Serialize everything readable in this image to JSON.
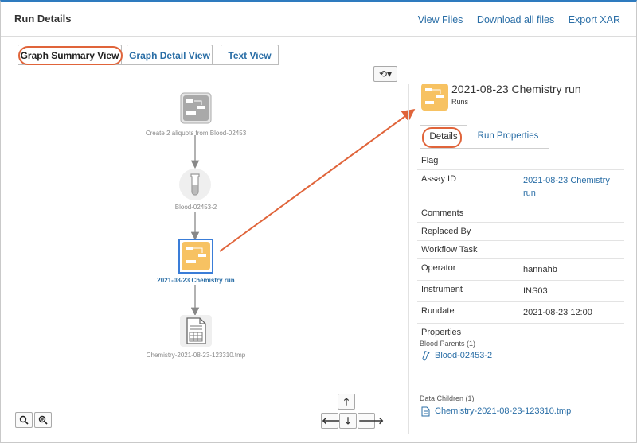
{
  "header": {
    "title": "Run Details",
    "links": [
      "View Files",
      "Download all files",
      "Export XAR"
    ]
  },
  "tabs": [
    "Graph Summary View",
    "Graph Detail View",
    "Text View"
  ],
  "reset_icon": "refresh-dropdown-icon",
  "graph": {
    "nodes": [
      {
        "label": "Create 2 aliquots from Blood-02453",
        "icon": "protocol-icon"
      },
      {
        "label": "Blood-02453-2",
        "icon": "test-tube-icon"
      },
      {
        "label": "2021-08-23 Chemistry run",
        "icon": "assay-run-icon"
      },
      {
        "label": "Chemistry-2021-08-23-123310.tmp",
        "icon": "data-file-icon"
      }
    ]
  },
  "zoom": {
    "zoom_out": "zoom-out-icon",
    "zoom_in": "zoom-in-icon"
  },
  "nav_glyphs": {
    "up": "🡑",
    "left": "🡐",
    "down": "🡓",
    "right": "🡒"
  },
  "detail": {
    "title": "2021-08-23 Chemistry run",
    "subtitle": "Runs",
    "tabs": [
      "Details",
      "Run Properties"
    ],
    "properties": [
      {
        "key": "Flag",
        "value": ""
      },
      {
        "key": "Assay ID",
        "value": "2021-08-23 Chemistry run"
      },
      {
        "key": "Comments",
        "value": ""
      },
      {
        "key": "Replaced By",
        "value": ""
      },
      {
        "key": "Workflow Task",
        "value": ""
      },
      {
        "key": "Operator",
        "value": "hannahb"
      },
      {
        "key": "Instrument",
        "value": "INS03"
      },
      {
        "key": "Rundate",
        "value": "2021-08-23 12:00"
      },
      {
        "key": "Properties",
        "value": ""
      }
    ],
    "blood_parents_label": "Blood Parents (1)",
    "blood_parent": "Blood-02453-2",
    "data_children_label": "Data Children (1)",
    "data_child": "Chemistry-2021-08-23-123310.tmp"
  },
  "colors": {
    "accent": "#2a6ea6",
    "highlight": "#e0643a",
    "run_icon": "#f7c262"
  }
}
